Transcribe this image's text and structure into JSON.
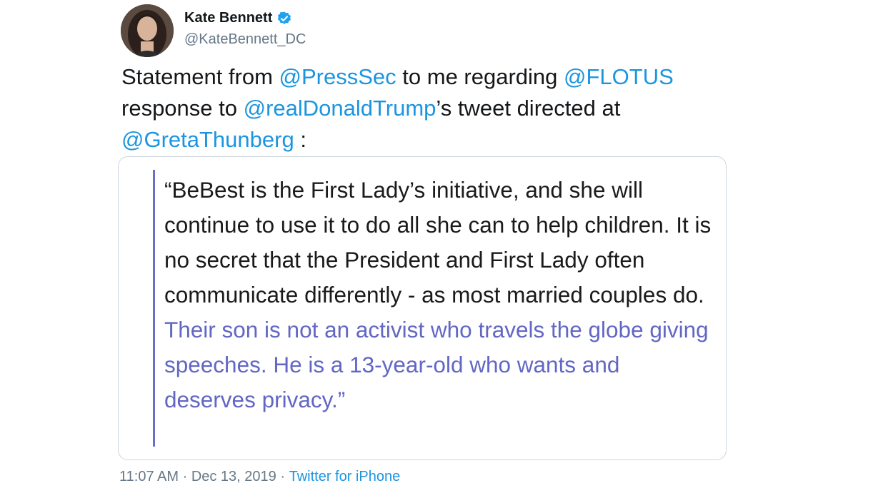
{
  "author": {
    "name": "Kate Bennett",
    "handle": "@KateBennett_DC"
  },
  "tweet": {
    "t1": "Statement from ",
    "m1": "@PressSec",
    "t2": " to me regarding ",
    "m2": "@FLOTUS",
    "t3": " response to ",
    "m3": "@realDonaldTrump",
    "t4": "’s tweet directed at ",
    "m4": "@GretaThunberg",
    "t5": " :"
  },
  "quote": {
    "plain": "“BeBest is the First Lady’s initiative, and she will continue to use it to do all she can to help children. It is no secret that the President and First Lady often communicate differently - as most married couples do. ",
    "highlighted": "Their son is not an activist who travels the globe giving speeches. He is a 13-year-old who wants and deserves privacy.”"
  },
  "meta": {
    "time": "11:07 AM",
    "sep1": " · ",
    "date": "Dec 13, 2019",
    "sep2": " · ",
    "source": "Twitter for iPhone"
  },
  "colors": {
    "link": "#1b95e0",
    "quote_highlight": "#6266c4",
    "verified": "#1da1f2"
  }
}
